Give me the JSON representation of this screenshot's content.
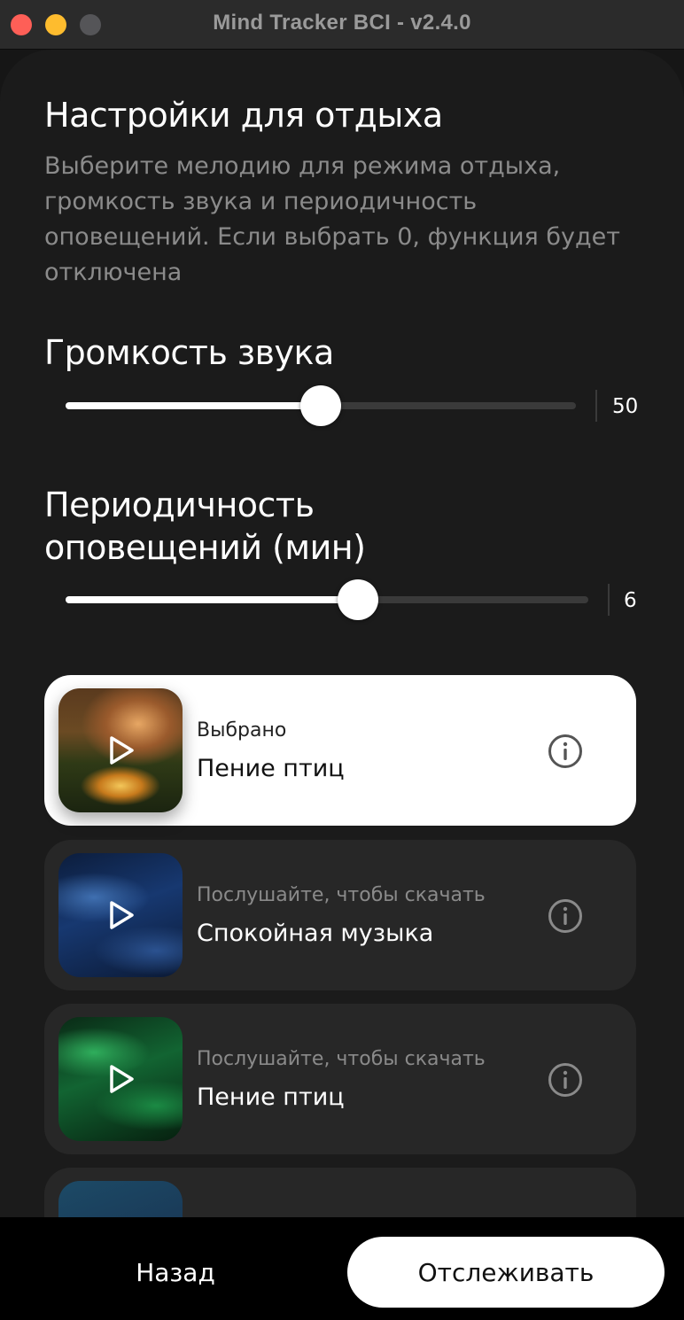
{
  "window": {
    "title": "Mind Tracker BCI - v2.4.0"
  },
  "settings": {
    "heading": "Настройки для отдыха",
    "description": "Выберите мелодию для режима отдыха, громкость звука и периодичность оповещений. Если выбрать 0, функция будет отключена"
  },
  "volume": {
    "label": "Громкость звука",
    "value": "50",
    "fraction": 0.5
  },
  "interval": {
    "label": "Периодичность оповещений (мин)",
    "value": "6",
    "fraction": 0.56
  },
  "melodies": [
    {
      "subtitle": "Выбрано",
      "title": "Пение птиц",
      "selected": true,
      "thumb": "forest-sunset",
      "play_icon": "play-icon",
      "info_icon": "info-icon"
    },
    {
      "subtitle": "Послушайте, чтобы скачать",
      "title": "Спокойная музыка",
      "selected": false,
      "thumb": "blue-waves",
      "play_icon": "play-icon",
      "info_icon": "info-icon"
    },
    {
      "subtitle": "Послушайте, чтобы скачать",
      "title": "Пение птиц",
      "selected": false,
      "thumb": "green-waves",
      "play_icon": "play-icon",
      "info_icon": "info-icon"
    }
  ],
  "footer": {
    "back_label": "Назад",
    "track_label": "Отслеживать"
  },
  "colors": {
    "background": "#1b1b1b",
    "card": "#272727",
    "selected_card": "#ffffff",
    "accent": "#ffffff"
  }
}
